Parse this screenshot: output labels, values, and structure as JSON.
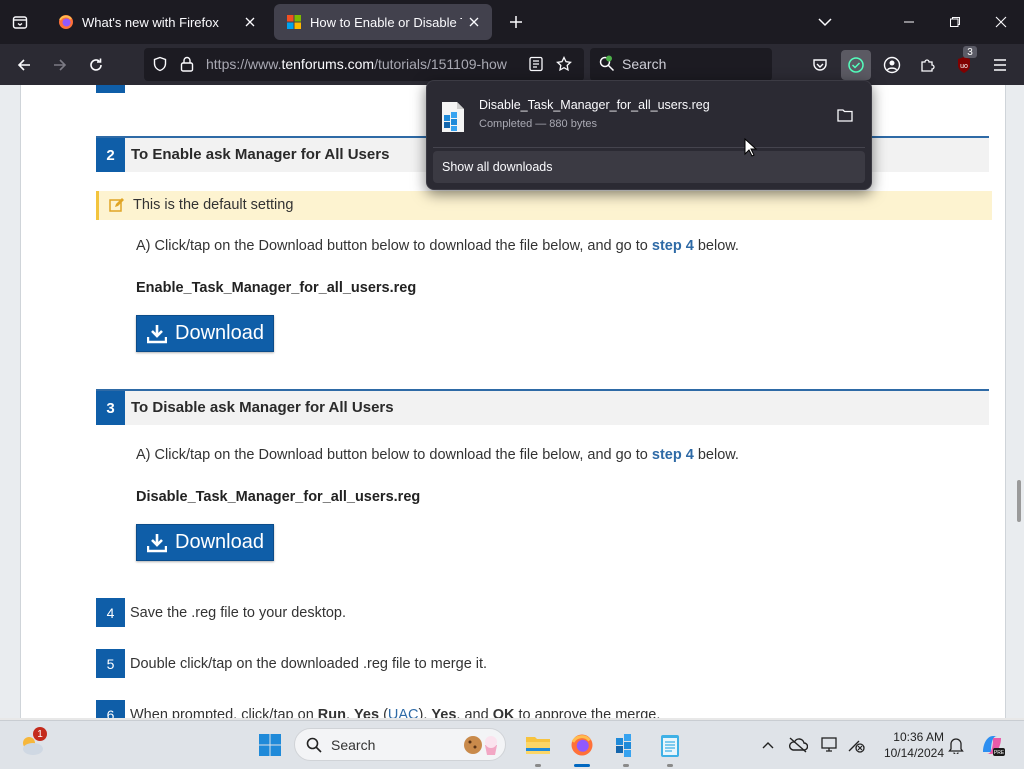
{
  "browser": {
    "tabs": [
      {
        "title": "What's new with Firefox"
      },
      {
        "title": "How to Enable or Disable Task Manager"
      }
    ],
    "url": "https://www.tenforums.com/tutorials/151109-how",
    "url_host_prefix": "https://www.",
    "url_host": "tenforums.com",
    "url_path": "/tutorials/151109-how",
    "search_placeholder": "Search",
    "extension_badge_count": "3"
  },
  "downloads_panel": {
    "file_name": "Disable_Task_Manager_for_all_users.reg",
    "status": "Completed — 880 bytes",
    "show_all_label": "Show all downloads"
  },
  "article": {
    "step2": {
      "num": "2",
      "title": "To Enable ask Manager for All Users"
    },
    "note": "This is the default setting",
    "step2_para_a": "A) Click/tap on the Download button below to download the file below, and go to ",
    "step2_link": "step 4",
    "step2_para_b": " below.",
    "step2_file": "Enable_Task_Manager_for_all_users.reg",
    "download_label": "Download",
    "step3": {
      "num": "3",
      "title": "To Disable ask Manager for All Users"
    },
    "step3_para_a": "A) Click/tap on the Download button below to download the file below, and go to ",
    "step3_link": "step 4",
    "step3_para_b": " below.",
    "step3_file": "Disable_Task_Manager_for_all_users.reg",
    "step4": {
      "num": "4",
      "text": "Save the .reg file to your desktop."
    },
    "step5": {
      "num": "5",
      "text": "Double click/tap on the downloaded .reg file to merge it."
    },
    "step6": {
      "num": "6",
      "text_a": "When prompted, click/tap on ",
      "run_yes": "Run",
      "sep1": ", ",
      "yes1": "Yes",
      "uac_open": " (",
      "uac": "UAC",
      "uac_close": "), ",
      "yes2": "Yes",
      "and": ", and ",
      "ok": "OK",
      "text_b": " to approve the merge."
    }
  },
  "taskbar": {
    "search_placeholder": "Search",
    "time": "10:36 AM",
    "date": "10/14/2024",
    "weather_badge": "1"
  },
  "colors": {
    "accent": "#0f5ea8",
    "link": "#2e6aa6",
    "note_bg": "#fdf3d0"
  }
}
